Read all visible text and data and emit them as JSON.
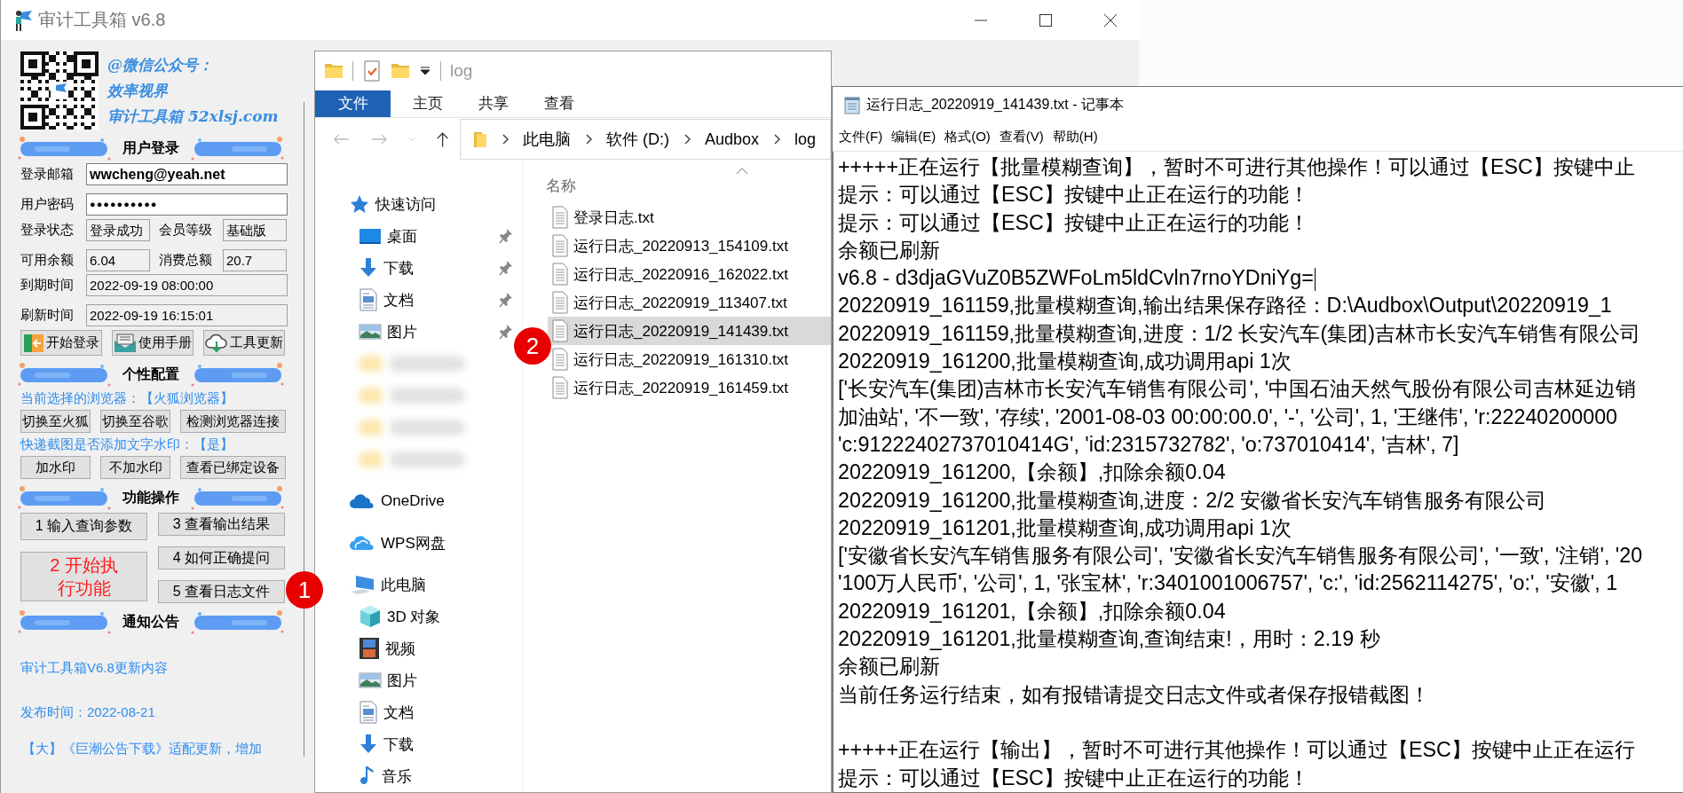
{
  "app_window": {
    "title": "审计工具箱 v6.8",
    "promo": [
      "@微信公众号：",
      "效率视界",
      "审计工具箱 52xlsj.com"
    ],
    "login_header": "用户登录",
    "login_rows": [
      [
        {
          "label": "登录邮箱",
          "value": "wwcheng@yeah.net",
          "kind": "email"
        }
      ],
      [
        {
          "label": "用户密码",
          "value": "●●●●●●●●●●",
          "kind": "password"
        }
      ],
      [
        {
          "label": "登录状态",
          "value": "登录成功",
          "kind": "readonly"
        },
        {
          "label": "会员等级",
          "value": "基础版",
          "kind": "readonly"
        }
      ],
      [
        {
          "label": "可用余额",
          "value": "6.04",
          "kind": "readonly"
        },
        {
          "label": "消费总额",
          "value": "20.7",
          "kind": "readonly"
        }
      ],
      [
        {
          "label": "到期时间",
          "value": "2022-09-19 08:00:00",
          "kind": "readonly"
        }
      ],
      [
        {
          "label": "刷新时间",
          "value": "2022-09-19 16:15:01",
          "kind": "readonly"
        }
      ]
    ],
    "login_buttons": [
      {
        "label": "开始登录",
        "kind": "door"
      },
      {
        "label": "使用手册",
        "kind": "book"
      },
      {
        "label": "工具更新",
        "kind": "cloud"
      }
    ],
    "config_header": "个性配置",
    "browser_note": "当前选择的浏览器：【火狐浏览器】",
    "browser_buttons": [
      "切换至火狐",
      "切换至谷歌",
      "检测浏览器连接"
    ],
    "watermark_note": "快递截图是否添加文字水印：【是】",
    "watermark_buttons": [
      "加水印",
      "不加水印",
      "查看已绑定设备"
    ],
    "ops_header": "功能操作",
    "ops_columns": [
      [
        {
          "label": "1 输入查询参数",
          "kind": "normal"
        },
        {
          "label": "2 开始执行功能",
          "kind": "primary"
        }
      ],
      [
        {
          "label": "3 查看输出结果",
          "kind": "normal"
        },
        {
          "label": "4 如何正确提问",
          "kind": "normal"
        },
        {
          "label": "5 查看日志文件",
          "kind": "normal"
        }
      ]
    ],
    "notice_header": "通知公告",
    "notices": [
      "审计工具箱V6.8更新内容",
      "发布时间：2022-08-21",
      "【大】《巨潮公告下载》适配更新，增加"
    ]
  },
  "explorer": {
    "title": "log",
    "ribbon_tabs": [
      {
        "label": "文件",
        "kind": "filemenu"
      },
      {
        "label": "主页",
        "kind": "tab"
      },
      {
        "label": "共享",
        "kind": "tab"
      },
      {
        "label": "查看",
        "kind": "tab"
      }
    ],
    "breadcrumb": [
      "此电脑",
      "软件 (D:)",
      "Audbox",
      "log"
    ],
    "nav": [
      {
        "label": "快速访问",
        "kind": "star",
        "children": [
          {
            "label": "桌面",
            "kind": "desktop",
            "pinned": true
          },
          {
            "label": "下载",
            "kind": "download",
            "pinned": true
          },
          {
            "label": "文档",
            "kind": "document",
            "pinned": true
          },
          {
            "label": "图片",
            "kind": "pictures",
            "pinned": true
          },
          {
            "kind": "blurred"
          },
          {
            "kind": "blurred"
          },
          {
            "kind": "blurred"
          },
          {
            "kind": "blurred"
          }
        ]
      },
      {
        "label": "OneDrive",
        "kind": "onedrive"
      },
      {
        "label": "WPS网盘",
        "kind": "wps"
      },
      {
        "label": "此电脑",
        "kind": "computer",
        "children": [
          {
            "label": "3D 对象",
            "kind": "cube",
            "pinned": false
          },
          {
            "label": "视频",
            "kind": "video",
            "pinned": false
          },
          {
            "label": "图片",
            "kind": "pictures",
            "pinned": false
          },
          {
            "label": "文档",
            "kind": "document",
            "pinned": false
          },
          {
            "label": "下载",
            "kind": "download",
            "pinned": false
          },
          {
            "label": "音乐",
            "kind": "music",
            "pinned": false
          }
        ]
      }
    ],
    "column": "名称",
    "files": [
      {
        "name": "登录日志.txt",
        "selected": false
      },
      {
        "name": "运行日志_20220913_154109.txt",
        "selected": false
      },
      {
        "name": "运行日志_20220916_162022.txt",
        "selected": false
      },
      {
        "name": "运行日志_20220919_113407.txt",
        "selected": false
      },
      {
        "name": "运行日志_20220919_141439.txt",
        "selected": true
      },
      {
        "name": "运行日志_20220919_161310.txt",
        "selected": false
      },
      {
        "name": "运行日志_20220919_161459.txt",
        "selected": false
      }
    ]
  },
  "notepad": {
    "title": "运行日志_20220919_141439.txt - 记事本",
    "menu": [
      "文件(F)",
      "编辑(E)",
      "格式(O)",
      "查看(V)",
      "帮助(H)"
    ],
    "lines": [
      {
        "kind": "text",
        "text": "+++++正在运行【批量模糊查询】，暂时不可进行其他操作！可以通过【ESC】按键中止",
        "cursor": false
      },
      {
        "kind": "text",
        "text": "提示：可以通过【ESC】按键中止正在运行的功能！",
        "cursor": false
      },
      {
        "kind": "text",
        "text": "提示：可以通过【ESC】按键中止正在运行的功能！",
        "cursor": false
      },
      {
        "kind": "text",
        "text": "余额已刷新",
        "cursor": false
      },
      {
        "kind": "text",
        "text": "v6.8 - d3djaGVuZ0B5ZWFoLm5ldCvln7rnoYDniYg=",
        "cursor": true
      },
      {
        "kind": "text",
        "text": "20220919_161159,批量模糊查询,输出结果保存路径：D:\\Audbox\\Output\\20220919_1",
        "cursor": false
      },
      {
        "kind": "text",
        "text": "20220919_161159,批量模糊查询,进度：1/2 长安汽车(集团)吉林市长安汽车销售有限公司",
        "cursor": false
      },
      {
        "kind": "text",
        "text": "20220919_161200,批量模糊查询,成功调用api 1次",
        "cursor": false
      },
      {
        "kind": "text",
        "text": "['长安汽车(集团)吉林市长安汽车销售有限公司', '中国石油天然气股份有限公司吉林延边销",
        "cursor": false
      },
      {
        "kind": "text",
        "text": "加油站', '不一致', '存续', '2001-08-03 00:00:00.0', '-', '公司', 1, '王继伟', 'r:22240200000",
        "cursor": false
      },
      {
        "kind": "text",
        "text": "'c:91222402737010414G', 'id:2315732782', 'o:737010414', '吉林', 7]",
        "cursor": false
      },
      {
        "kind": "text",
        "text": "20220919_161200,【余额】,扣除余额0.04",
        "cursor": false
      },
      {
        "kind": "text",
        "text": "20220919_161200,批量模糊查询,进度：2/2 安徽省长安汽车销售服务有限公司",
        "cursor": false
      },
      {
        "kind": "text",
        "text": "20220919_161201,批量模糊查询,成功调用api 1次",
        "cursor": false
      },
      {
        "kind": "text",
        "text": "['安徽省长安汽车销售服务有限公司', '安徽省长安汽车销售服务有限公司', '一致', '注销', '20",
        "cursor": false
      },
      {
        "kind": "text",
        "text": "'100万人民币', '公司', 1, '张宝林', 'r:3401001006757', 'c:', 'id:2562114275', 'o:', '安徽', 1",
        "cursor": false
      },
      {
        "kind": "text",
        "text": "20220919_161201,【余额】,扣除余额0.04",
        "cursor": false
      },
      {
        "kind": "text",
        "text": "20220919_161201,批量模糊查询,查询结束!，用时：2.19 秒",
        "cursor": false
      },
      {
        "kind": "text",
        "text": "余额已刷新",
        "cursor": false
      },
      {
        "kind": "text",
        "text": "当前任务运行结束，如有报错请提交日志文件或者保存报错截图！",
        "cursor": false
      },
      {
        "kind": "blank",
        "cursor": false
      },
      {
        "kind": "text",
        "text": "+++++正在运行【输出】，暂时不可进行其他操作！可以通过【ESC】按键中止正在运行",
        "cursor": false
      },
      {
        "kind": "text",
        "text": "提示：可以通过【ESC】按键中止正在运行的功能！",
        "cursor": false
      }
    ]
  },
  "markers": [
    {
      "label": "1"
    },
    {
      "label": "2"
    }
  ]
}
